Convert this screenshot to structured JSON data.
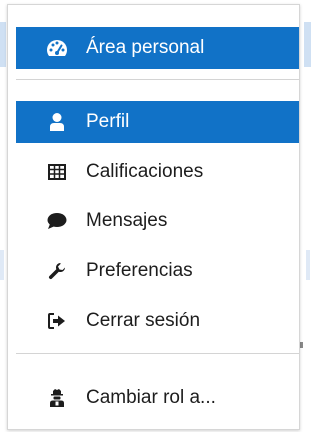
{
  "menu": {
    "items": [
      {
        "label": "Área personal",
        "icon": "dashboard-icon",
        "active": true
      },
      {
        "label": "Perfil",
        "icon": "user-icon",
        "active": true
      },
      {
        "label": "Calificaciones",
        "icon": "table-icon",
        "active": false
      },
      {
        "label": "Mensajes",
        "icon": "chat-bubble-icon",
        "active": false
      },
      {
        "label": "Preferencias",
        "icon": "wrench-icon",
        "active": false
      },
      {
        "label": "Cerrar sesión",
        "icon": "sign-out-icon",
        "active": false
      },
      {
        "label": "Cambiar rol a...",
        "icon": "user-secret-icon",
        "active": false
      }
    ]
  },
  "colors": {
    "accent": "#1172c7",
    "text": "#1d1d1d",
    "divider": "#d4d4d4"
  }
}
